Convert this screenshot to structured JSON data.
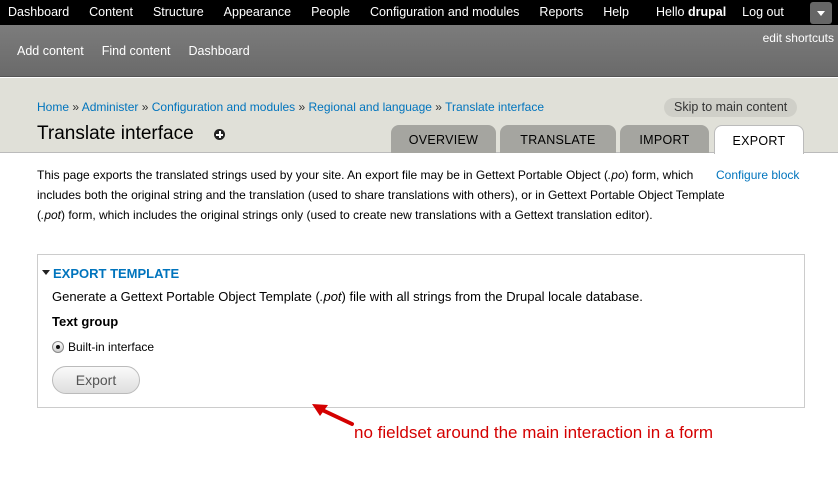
{
  "toolbar": {
    "menu": [
      "Dashboard",
      "Content",
      "Structure",
      "Appearance",
      "People",
      "Configuration and modules",
      "Reports",
      "Help"
    ],
    "hello_prefix": "Hello ",
    "user_name": "drupal",
    "logout": "Log out"
  },
  "shortcuts": {
    "links": [
      "Add content",
      "Find content",
      "Dashboard"
    ],
    "edit": "edit shortcuts"
  },
  "breadcrumb": [
    "Home",
    "Administer",
    "Configuration and modules",
    "Regional and language",
    "Translate interface"
  ],
  "breadcrumb_separator": " » ",
  "skip_link": "Skip to main content",
  "page_title": "Translate interface",
  "tabs": [
    "OVERVIEW",
    "TRANSLATE",
    "IMPORT",
    "EXPORT"
  ],
  "active_tab": "EXPORT",
  "help": {
    "part1": "This page exports the translated strings used by your site. An export file may be in Gettext Portable Object (",
    "po": ".po",
    "part2": ") form, which includes both the original string and the translation (used to share translations with others), or in Gettext Portable Object Template (",
    "pot": ".pot",
    "part3": ") form, which includes the original strings only (used to create new translations with a Gettext translation editor)."
  },
  "configure_block": "Configure block",
  "fieldset": {
    "legend": "EXPORT TEMPLATE",
    "desc_part1": "Generate a Gettext Portable Object Template (",
    "desc_pot": ".pot",
    "desc_part2": ") file with all strings from the Drupal locale database.",
    "group_label": "Text group",
    "radio_label": "Built-in interface",
    "radio_selected": true,
    "button": "Export"
  },
  "annotation": "no fieldset around the main interaction in a form",
  "colors": {
    "link": "#0074bd",
    "annotation": "#d40000",
    "toolbar": "#000000",
    "shortcuts": "#737373",
    "branding": "#e0e0d8"
  }
}
